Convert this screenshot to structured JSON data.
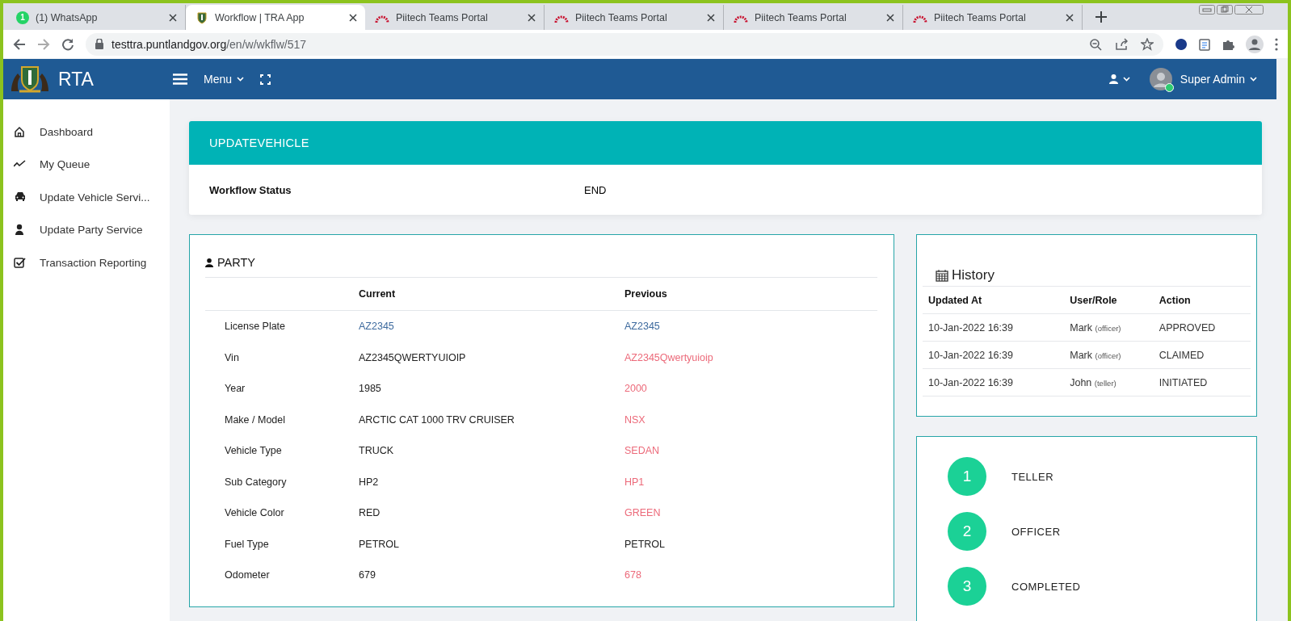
{
  "browser": {
    "tabs": [
      {
        "title": "(1) WhatsApp",
        "kind": "chat",
        "badge": "1",
        "selected": false
      },
      {
        "title": "Workflow | TRA App",
        "kind": "crest",
        "selected": true
      },
      {
        "title": "Piitech Teams Portal",
        "kind": "arch",
        "selected": false
      },
      {
        "title": "Piitech Teams Portal",
        "kind": "arch",
        "selected": false
      },
      {
        "title": "Piitech Teams Portal",
        "kind": "arch",
        "selected": false
      },
      {
        "title": "Piitech Teams Portal",
        "kind": "arch",
        "selected": false
      }
    ],
    "address": {
      "host": "testtra.puntlandgov.org",
      "path": "/en/w/wkflw/517"
    }
  },
  "header": {
    "brand": "RTA",
    "menu": "Menu",
    "user": "Super Admin",
    "online": true
  },
  "sidebar": {
    "items": [
      {
        "label": "Dashboard",
        "kind": "home"
      },
      {
        "label": "My Queue",
        "kind": "trend"
      },
      {
        "label": "Update Vehicle Servi...",
        "kind": "car"
      },
      {
        "label": "Update Party Service",
        "kind": "user"
      },
      {
        "label": "Transaction Reporting",
        "kind": "check"
      }
    ]
  },
  "title_card": {
    "title": "UPDATEVEHICLE",
    "status_label": "Workflow Status",
    "status_value": "END"
  },
  "party": {
    "title": "PARTY",
    "columns": [
      "Current",
      "Previous"
    ],
    "rows": [
      {
        "field": "License Plate",
        "current": "AZ2345",
        "previous": "AZ2345",
        "kind": "link",
        "changed": false
      },
      {
        "field": "Vin",
        "current": "AZ2345QWERTYUIOIP",
        "previous": "AZ2345Qwertyuioip",
        "kind": "text",
        "changed": true
      },
      {
        "field": "Year",
        "current": "1985",
        "previous": "2000",
        "kind": "text",
        "changed": true
      },
      {
        "field": "Make / Model",
        "current": "ARCTIC CAT 1000 TRV CRUISER",
        "previous": "NSX",
        "kind": "text",
        "changed": true
      },
      {
        "field": "Vehicle Type",
        "current": "TRUCK",
        "previous": "SEDAN",
        "kind": "text",
        "changed": true
      },
      {
        "field": "Sub Category",
        "current": "HP2",
        "previous": "HP1",
        "kind": "text",
        "changed": true
      },
      {
        "field": "Vehicle Color",
        "current": "RED",
        "previous": "GREEN",
        "kind": "text",
        "changed": true
      },
      {
        "field": "Fuel Type",
        "current": "PETROL",
        "previous": "PETROL",
        "kind": "text",
        "changed": false
      },
      {
        "field": "Odometer",
        "current": "679",
        "previous": "678",
        "kind": "text",
        "changed": true
      }
    ]
  },
  "history": {
    "title": "History",
    "columns": [
      "Updated At",
      "User/Role",
      "Action"
    ],
    "rows": [
      {
        "updated_at": "10-Jan-2022 16:39",
        "user": "Mark",
        "role": "(officer)",
        "action": "APPROVED"
      },
      {
        "updated_at": "10-Jan-2022 16:39",
        "user": "Mark",
        "role": "(officer)",
        "action": "CLAIMED"
      },
      {
        "updated_at": "10-Jan-2022 16:39",
        "user": "John",
        "role": "(teller)",
        "action": "INITIATED"
      }
    ]
  },
  "steps": [
    {
      "number": "1",
      "label": "TELLER"
    },
    {
      "number": "2",
      "label": "OFFICER"
    },
    {
      "number": "3",
      "label": "COMPLETED"
    }
  ]
}
